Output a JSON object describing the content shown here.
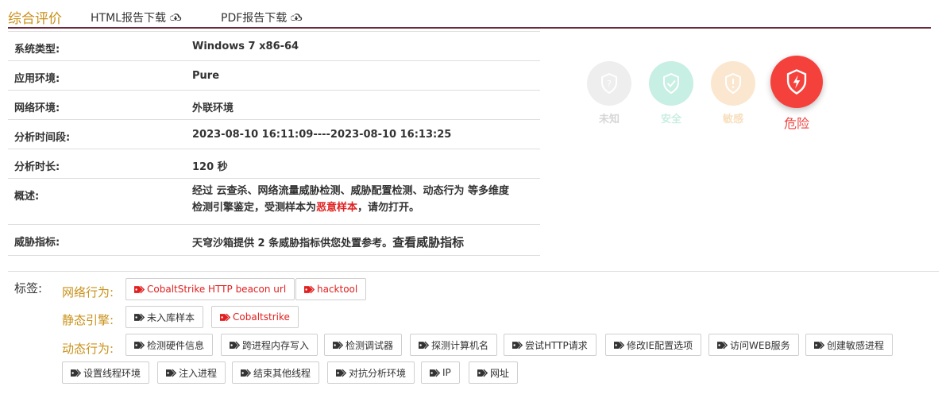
{
  "header": {
    "title": "综合评价",
    "html_download": "HTML报告下载",
    "pdf_download": "PDF报告下载"
  },
  "info": {
    "system_type": {
      "label": "系统类型:",
      "value": "Windows 7 x86-64"
    },
    "app_env": {
      "label": "应用环境:",
      "value": "Pure"
    },
    "net_env": {
      "label": "网络环境:",
      "value": "外联环境"
    },
    "time_range": {
      "label": "分析时间段:",
      "value": "2023-08-10 16:11:09----2023-08-10 16:13:25"
    },
    "duration": {
      "label": "分析时长:",
      "value": "120 秒"
    },
    "summary": {
      "label": "概述:",
      "line1": "经过 云查杀、网络流量威胁检测、威胁配置检测、动态行为 等多维度",
      "line2_prefix": "检测引擎鉴定，受测样本为",
      "line2_highlight": "恶意样本",
      "line2_suffix": "，请勿打开。"
    },
    "indicators": {
      "label": "威胁指标:",
      "text": "天穹沙箱提供 2 条威胁指标供您处置参考。",
      "link": "查看威胁指标"
    }
  },
  "verdicts": {
    "unknown": "未知",
    "safe": "安全",
    "sensitive": "敏感",
    "danger": "危险",
    "active": "danger"
  },
  "tags": {
    "label": "标签:",
    "network": {
      "label": "网络行为:",
      "items": [
        "CobaltStrike HTTP beacon url",
        "hacktool"
      ]
    },
    "static": {
      "label": "静态引擎:",
      "items": [
        "未入库样本",
        "Cobaltstrike"
      ]
    },
    "dynamic": {
      "label": "动态行为:",
      "items": [
        "检测硬件信息",
        "跨进程内存写入",
        "检测调试器",
        "探测计算机名",
        "尝试HTTP请求",
        "修改IE配置选项",
        "访问WEB服务",
        "创建敏感进程",
        "设置线程环境",
        "注入进程",
        "结束其他线程",
        "对抗分析环境",
        "IP",
        "网址"
      ]
    }
  },
  "colors": {
    "accent": "#c9911a",
    "danger": "#f5413c",
    "malicious_text": "#e02020",
    "header_rule": "#6b2a3a"
  }
}
